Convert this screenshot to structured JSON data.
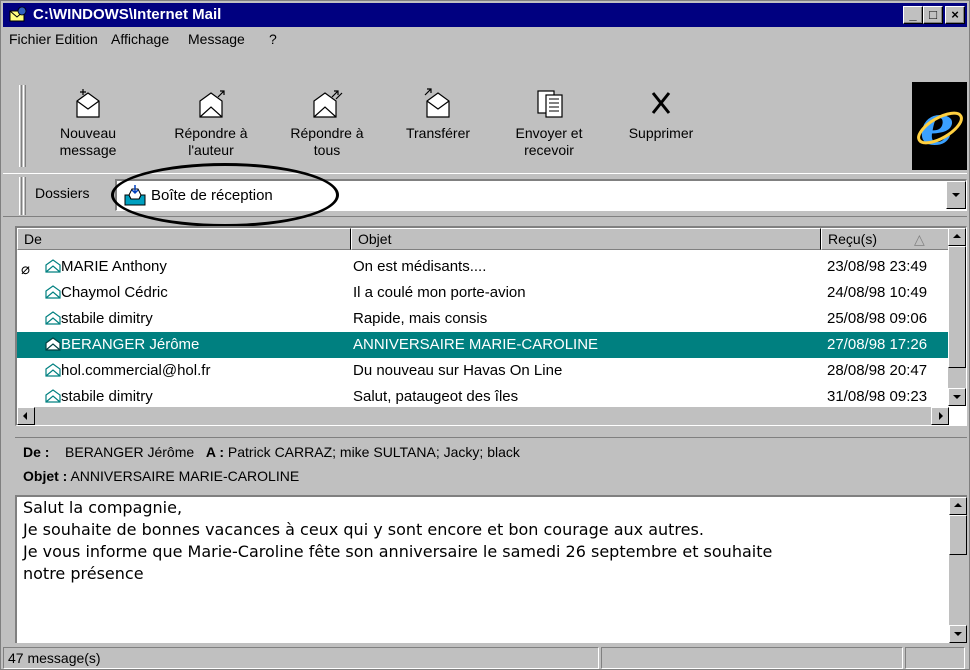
{
  "window": {
    "title": "C:\\WINDOWS\\Internet Mail"
  },
  "titlebar_buttons": {
    "minimize": "_",
    "maximize": "□",
    "close": "×"
  },
  "menu": [
    {
      "label": "Fichier"
    },
    {
      "label": "Edition"
    },
    {
      "label": "Affichage"
    },
    {
      "label": "Message"
    },
    {
      "label": "?"
    }
  ],
  "toolbar": {
    "buttons": [
      {
        "line1": "Nouveau",
        "line2": "message",
        "icon": "new-message-icon"
      },
      {
        "line1": "Répondre à",
        "line2": "l'auteur",
        "icon": "reply-author-icon"
      },
      {
        "line1": "Répondre à",
        "line2": "tous",
        "icon": "reply-all-icon"
      },
      {
        "line1": "Transférer",
        "line2": "",
        "icon": "forward-icon"
      },
      {
        "line1": "Envoyer et",
        "line2": "recevoir",
        "icon": "send-receive-icon"
      },
      {
        "line1": "Supprimer",
        "line2": "",
        "icon": "delete-icon"
      }
    ]
  },
  "folders": {
    "label": "Dossiers",
    "selected": "Boîte de réception"
  },
  "list": {
    "headers": {
      "from": "De",
      "subject": "Objet",
      "received": "Reçu(s)"
    },
    "rows": [
      {
        "from": "MARIE Anthony",
        "subject": "On est médisants....",
        "received": "23/08/98 23:49",
        "attachment": true,
        "selected": false
      },
      {
        "from": "Chaymol Cédric",
        "subject": "Il a coulé mon porte-avion",
        "received": "24/08/98 10:49",
        "attachment": false,
        "selected": false
      },
      {
        "from": "stabile dimitry",
        "subject": "Rapide, mais consis",
        "received": "25/08/98 09:06",
        "attachment": false,
        "selected": false
      },
      {
        "from": "BERANGER Jérôme",
        "subject": "ANNIVERSAIRE MARIE-CAROLINE",
        "received": "27/08/98 17:26",
        "attachment": false,
        "selected": true
      },
      {
        "from": "hol.commercial@hol.fr",
        "subject": "Du nouveau sur Havas On Line",
        "received": "28/08/98 20:47",
        "attachment": false,
        "selected": false
      },
      {
        "from": "stabile dimitry",
        "subject": "Salut, pataugeot des îles",
        "received": "31/08/98 09:23",
        "attachment": false,
        "selected": false
      }
    ]
  },
  "preview": {
    "from_label": "De :",
    "from": "BERANGER Jérôme",
    "to_label": "A :",
    "to": "Patrick CARRAZ; mike SULTANA; Jacky; black",
    "subject_label": "Objet :",
    "subject": "ANNIVERSAIRE MARIE-CAROLINE",
    "body": "Salut la compagnie,\nJe souhaite de bonnes vacances à ceux qui y sont encore et bon courage aux autres.\nJe vous informe que Marie-Caroline fête son anniversaire le samedi 26 septembre et souhaite\nnotre présence"
  },
  "status": {
    "count": "47 message(s)"
  },
  "colors": {
    "titlebar": "#000080",
    "selection": "#008080",
    "face": "#c0c0c0"
  }
}
